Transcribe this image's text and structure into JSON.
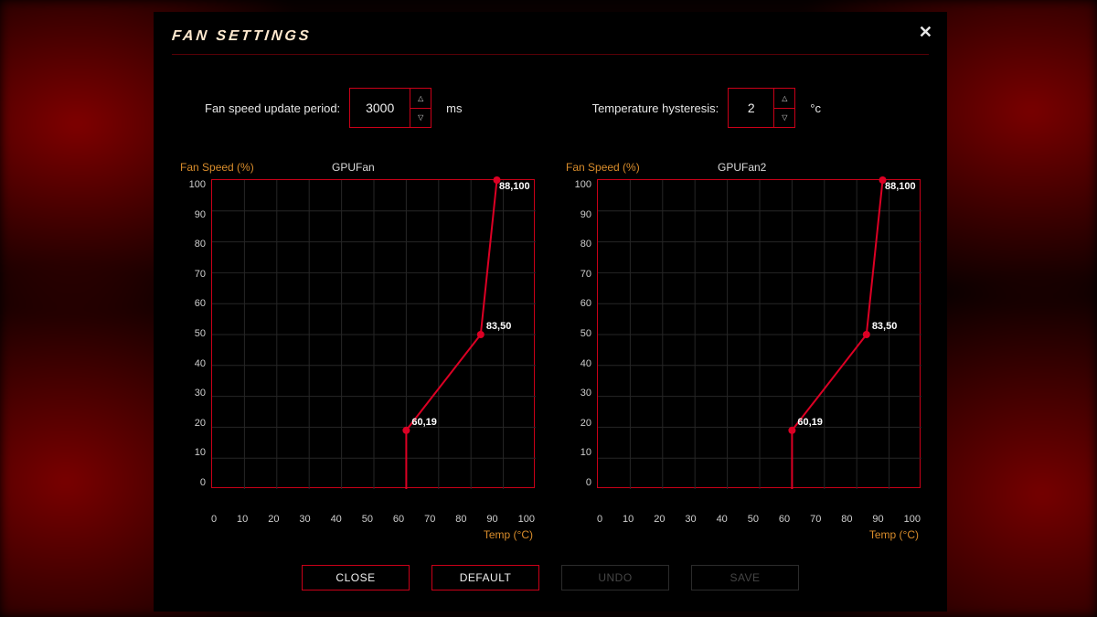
{
  "colors": {
    "accent": "#c90018",
    "label": "#d88c2b"
  },
  "dialog": {
    "title": "FAN SETTINGS",
    "close_aria": "Close"
  },
  "settings": {
    "update_period": {
      "label": "Fan speed update period:",
      "value": "3000",
      "unit": "ms"
    },
    "hysteresis": {
      "label": "Temperature hysteresis:",
      "value": "2",
      "unit": "°c"
    }
  },
  "axis": {
    "ylabel": "Fan Speed (%)",
    "xlabel": "Temp (°C)",
    "x_range": [
      0,
      100
    ],
    "y_range": [
      0,
      100
    ],
    "x_ticks": [
      "0",
      "10",
      "20",
      "30",
      "40",
      "50",
      "60",
      "70",
      "80",
      "90",
      "100"
    ],
    "y_ticks": [
      "100",
      "90",
      "80",
      "70",
      "60",
      "50",
      "40",
      "30",
      "20",
      "10",
      "0"
    ]
  },
  "buttons": {
    "close": "CLOSE",
    "default": "DEFAULT",
    "undo": "UNDO",
    "save": "SAVE",
    "undo_enabled": false,
    "save_enabled": false
  },
  "chart_data": [
    {
      "type": "line",
      "name": "GPUFan",
      "xlabel": "Temp (°C)",
      "ylabel": "Fan Speed (%)",
      "xlim": [
        0,
        100
      ],
      "ylim": [
        0,
        100
      ],
      "x": [
        60,
        83,
        88
      ],
      "y": [
        19,
        50,
        100
      ],
      "point_labels": [
        "60,19",
        "83,50",
        "88,100"
      ]
    },
    {
      "type": "line",
      "name": "GPUFan2",
      "xlabel": "Temp (°C)",
      "ylabel": "Fan Speed (%)",
      "xlim": [
        0,
        100
      ],
      "ylim": [
        0,
        100
      ],
      "x": [
        60,
        83,
        88
      ],
      "y": [
        19,
        50,
        100
      ],
      "point_labels": [
        "60,19",
        "83,50",
        "88,100"
      ]
    }
  ]
}
